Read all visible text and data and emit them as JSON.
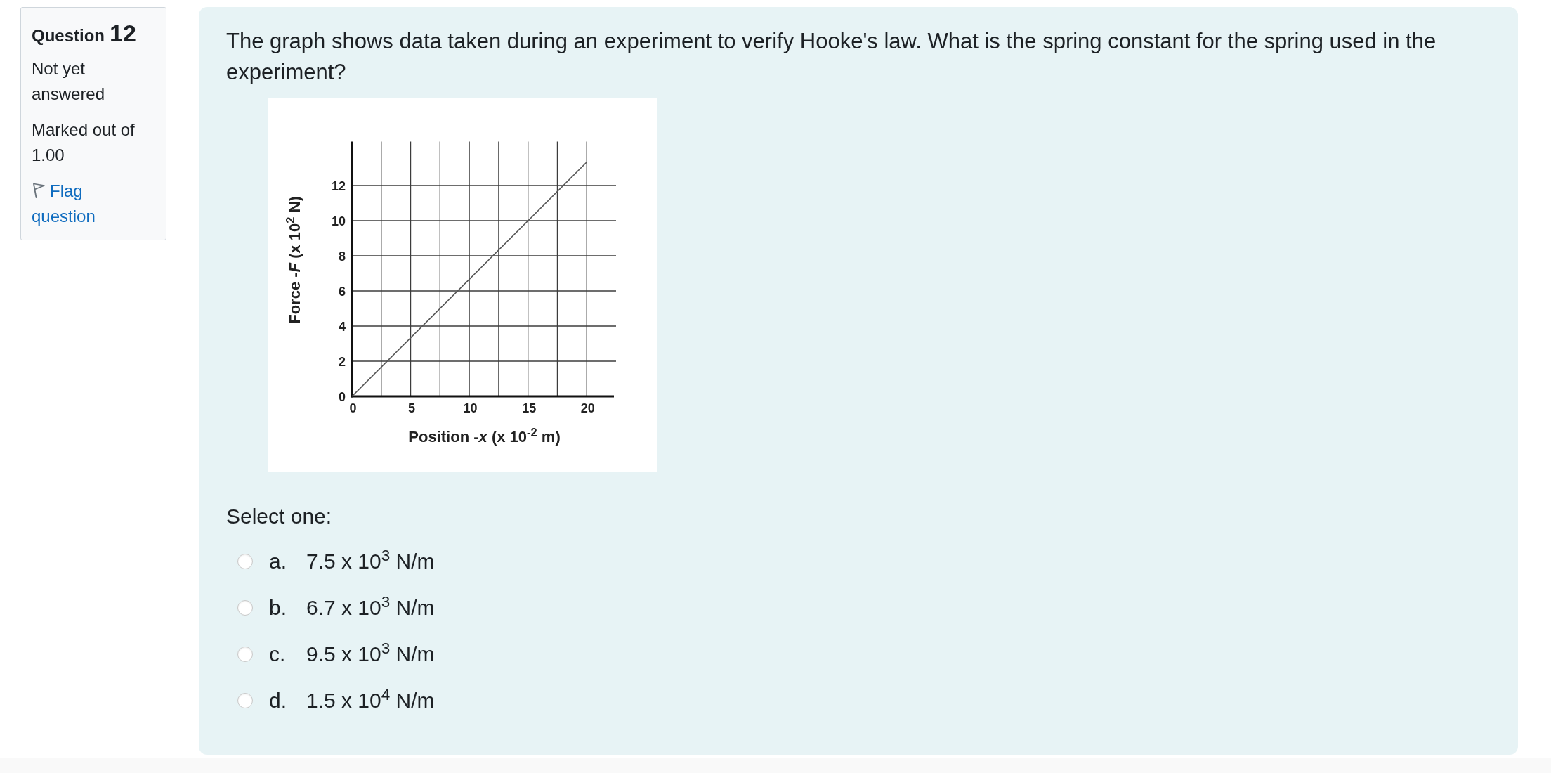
{
  "info": {
    "question_label": "Question",
    "question_number": "12",
    "status": "Not yet answered",
    "marks": "Marked out of 1.00",
    "flag_link": "Flag question",
    "flagged": false
  },
  "question": {
    "text": "The graph shows data taken during an experiment to verify Hooke's law. What is the spring constant for the spring used in the experiment?",
    "chart_data": {
      "type": "line",
      "xlabel": "Position -*x* (x 10$^{-2}$ m)",
      "ylabel": "Force -*F* (x 10$^{2}$ N)",
      "x": [
        0,
        20
      ],
      "series": [
        {
          "color": "#555555",
          "values": [
            0,
            13.33
          ]
        }
      ],
      "xlim": [
        0,
        22.5
      ],
      "ylim": [
        0,
        14.5
      ],
      "xticks": [
        0,
        5,
        10,
        15,
        20
      ],
      "yticks": [
        0,
        2,
        4,
        6,
        8,
        10,
        12
      ],
      "grid": true
    },
    "prompt": "Select one:",
    "options": [
      {
        "letter": "a.",
        "text": "7.5 x 10$^{3}$ N/m",
        "selected": false
      },
      {
        "letter": "b.",
        "text": "6.7 x 10$^{3}$ N/m",
        "selected": false
      },
      {
        "letter": "c.",
        "text": "9.5 x 10$^{3}$ N/m",
        "selected": false
      },
      {
        "letter": "d.",
        "text": "1.5 x 10$^{4}$ N/m",
        "selected": false
      }
    ]
  }
}
